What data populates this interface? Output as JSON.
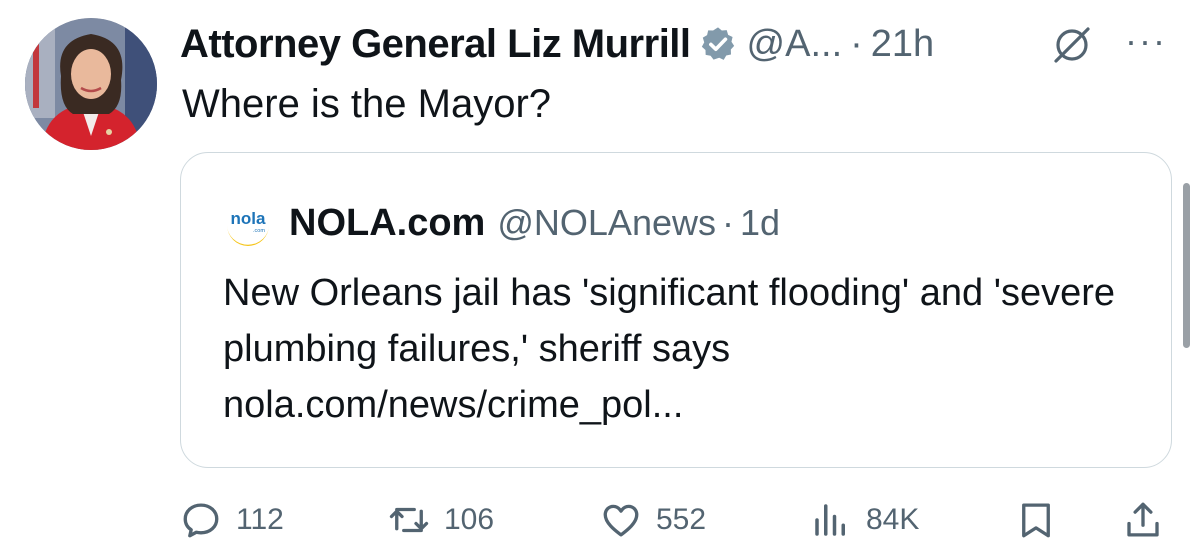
{
  "tweet": {
    "author_name": "Attorney General Liz Murrill",
    "author_handle": "@A...",
    "separator": "·",
    "time": "21h",
    "more_label": "···",
    "text": "Where is the Mayor?"
  },
  "quoted": {
    "logo_text": "nola",
    "logo_subtext": ".com",
    "author_name": "NOLA.com",
    "author_handle": "@NOLAnews",
    "separator": "·",
    "time": "1d",
    "text": "New Orleans jail has 'significant flooding' and 'severe plumbing failures,' sheriff says nola.com/news/crime_pol..."
  },
  "actions": {
    "replies": "112",
    "reposts": "106",
    "likes": "552",
    "views": "84K"
  },
  "colors": {
    "text": "#0f1419",
    "secondary": "#536471",
    "verified": "#829aab",
    "border": "#cfd9de",
    "nola_yellow": "#f5c51b",
    "nola_blue": "#1d74b8"
  }
}
